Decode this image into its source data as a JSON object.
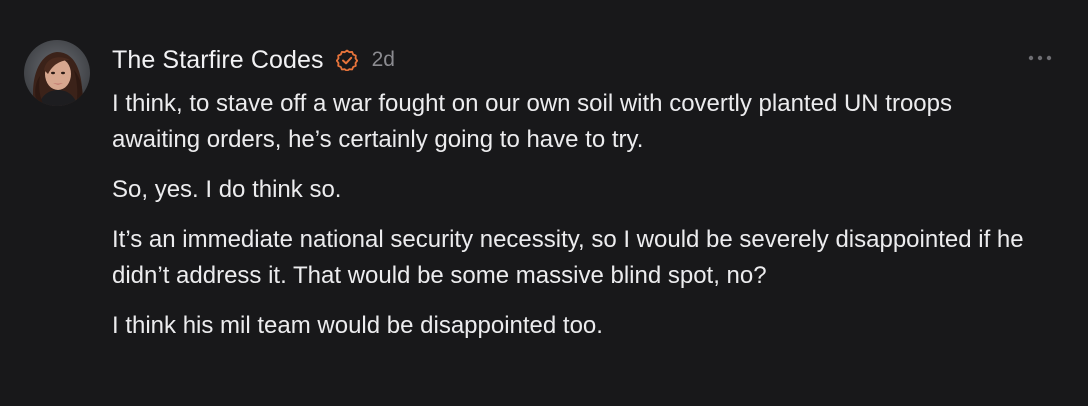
{
  "comment": {
    "author": "The Starfire Codes",
    "verified_icon": "verified-badge-icon",
    "timestamp": "2d",
    "more_icon": "more-options-icon",
    "accent_color": "#e8743b",
    "paragraphs": [
      "I think, to stave off a war fought on our own soil with covertly planted UN troops awaiting orders, he’s certainly going to have to try.",
      "So, yes. I do think so.",
      "It’s an immediate national security necessity, so I would be severely disappointed if he didn’t address it. That would be some massive blind spot, no?",
      "I think his mil team would be disappointed too."
    ]
  }
}
